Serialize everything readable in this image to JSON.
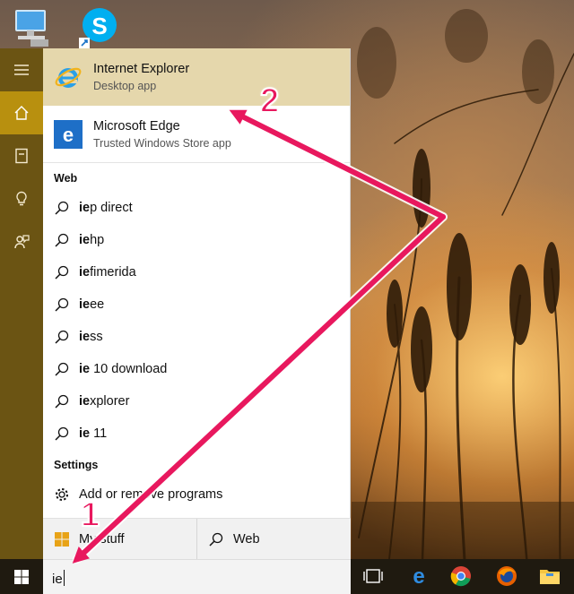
{
  "desktop": {
    "icons": [
      {
        "name": "this-pc",
        "label": ""
      },
      {
        "name": "skype",
        "label": ""
      }
    ]
  },
  "rail": {
    "items": [
      {
        "icon": "hamburger-menu-icon"
      },
      {
        "icon": "home-icon",
        "active": true
      },
      {
        "icon": "notebook-icon"
      },
      {
        "icon": "lightbulb-icon"
      },
      {
        "icon": "feedback-icon"
      }
    ]
  },
  "best_matches": [
    {
      "name": "Internet Explorer",
      "sub": "Desktop app",
      "icon": "internet-explorer-icon"
    },
    {
      "name": "Microsoft Edge",
      "sub": "Trusted Windows Store app",
      "icon": "microsoft-edge-icon"
    }
  ],
  "web": {
    "header": "Web",
    "results": [
      {
        "bold": "ie",
        "rest": "p direct"
      },
      {
        "bold": "ie",
        "rest": "hp"
      },
      {
        "bold": "ie",
        "rest": "fimerida"
      },
      {
        "bold": "ie",
        "rest": "ee"
      },
      {
        "bold": "ie",
        "rest": "ss"
      },
      {
        "bold": "ie",
        "rest": " 10 download"
      },
      {
        "bold": "ie",
        "rest": "xplorer"
      },
      {
        "bold": "ie",
        "rest": " 11"
      }
    ]
  },
  "settings": {
    "header": "Settings",
    "results": [
      {
        "label": "Add or remove programs",
        "icon": "gear-icon"
      }
    ]
  },
  "scope": {
    "my_stuff": "My stuff",
    "web": "Web"
  },
  "search": {
    "value": "ie"
  },
  "taskbar": {
    "icons": [
      "task-view-icon",
      "microsoft-edge-icon",
      "chrome-icon",
      "firefox-icon",
      "file-explorer-icon"
    ]
  },
  "annotations": {
    "callout_1": "1",
    "callout_2": "2",
    "arrow_color": "#e8185e"
  },
  "colors": {
    "rail": "#6b5413",
    "rail_active": "#b8900f",
    "selected_row": "#e5d7ac",
    "edge_blue": "#1e6fc7"
  }
}
